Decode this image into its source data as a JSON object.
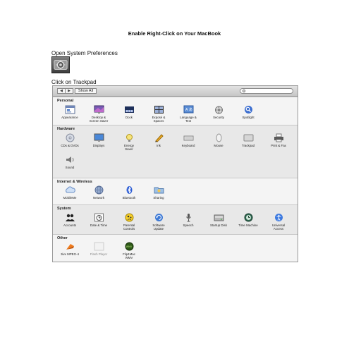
{
  "document": {
    "title": "Enable Right-Click on Your MacBook",
    "step1": "Open System Preferences",
    "step2": "Click on Trackpad"
  },
  "window": {
    "toolbar": {
      "back_label": "◀",
      "forward_label": "▶",
      "show_all_label": "Show All",
      "search_placeholder": ""
    },
    "sections": {
      "personal": {
        "label": "Personal",
        "items": [
          {
            "label": "Appearance",
            "icon": "appearance-icon"
          },
          {
            "label": "Desktop &\nScreen Saver",
            "icon": "desktop-icon"
          },
          {
            "label": "Dock",
            "icon": "dock-icon"
          },
          {
            "label": "Exposé &\nSpaces",
            "icon": "expose-icon"
          },
          {
            "label": "Language &\nText",
            "icon": "language-icon"
          },
          {
            "label": "Security",
            "icon": "security-icon"
          },
          {
            "label": "Spotlight",
            "icon": "spotlight-icon"
          }
        ]
      },
      "hardware": {
        "label": "Hardware",
        "items": [
          {
            "label": "CDs & DVDs",
            "icon": "cd-icon"
          },
          {
            "label": "Displays",
            "icon": "display-icon"
          },
          {
            "label": "Energy\nSaver",
            "icon": "energy-icon"
          },
          {
            "label": "Ink",
            "icon": "ink-icon"
          },
          {
            "label": "Keyboard",
            "icon": "keyboard-icon"
          },
          {
            "label": "Mouse",
            "icon": "mouse-icon"
          },
          {
            "label": "Trackpad",
            "icon": "trackpad-icon"
          },
          {
            "label": "Print & Fax",
            "icon": "printer-icon"
          },
          {
            "label": "Sound",
            "icon": "sound-icon"
          }
        ]
      },
      "internet": {
        "label": "Internet & Wireless",
        "items": [
          {
            "label": "MobileMe",
            "icon": "cloud-icon"
          },
          {
            "label": "Network",
            "icon": "network-icon"
          },
          {
            "label": "Bluetooth",
            "icon": "bluetooth-icon"
          },
          {
            "label": "Sharing",
            "icon": "sharing-icon"
          }
        ]
      },
      "system": {
        "label": "System",
        "items": [
          {
            "label": "Accounts",
            "icon": "accounts-icon"
          },
          {
            "label": "Date & Time",
            "icon": "clock-icon"
          },
          {
            "label": "Parental\nControls",
            "icon": "parental-icon"
          },
          {
            "label": "Software\nUpdate",
            "icon": "update-icon"
          },
          {
            "label": "Speech",
            "icon": "microphone-icon"
          },
          {
            "label": "Startup Disk",
            "icon": "disk-icon"
          },
          {
            "label": "Time Machine",
            "icon": "time-machine-icon"
          },
          {
            "label": "Universal\nAccess",
            "icon": "accessibility-icon"
          }
        ]
      },
      "other": {
        "label": "Other",
        "items": [
          {
            "label": "3ivx MPEG-4",
            "icon": "3ivx-icon"
          },
          {
            "label": "Flash Player",
            "icon": "flash-icon"
          },
          {
            "label": "Flip4Mac\nWMV",
            "icon": "flip4mac-icon"
          }
        ]
      }
    }
  }
}
